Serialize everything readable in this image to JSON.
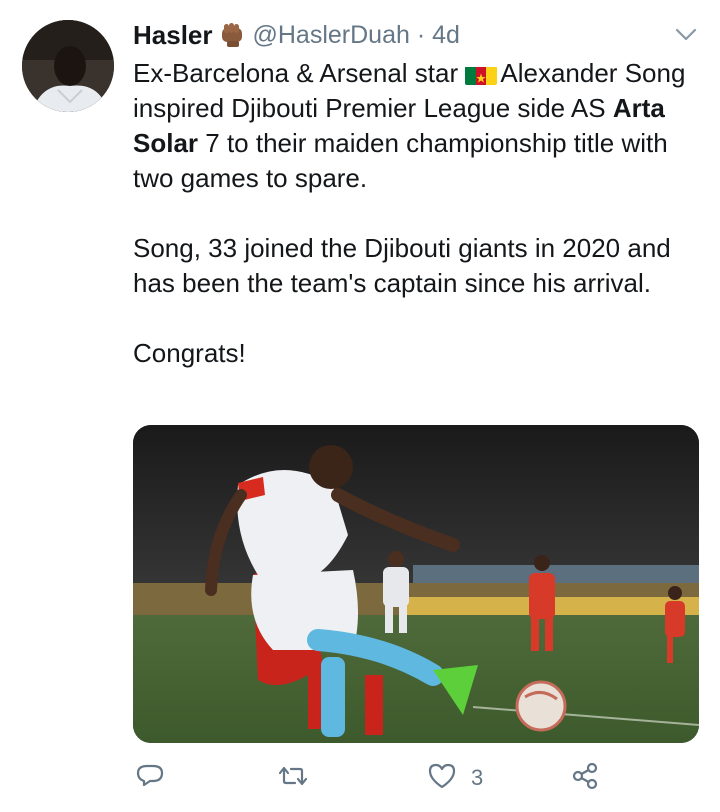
{
  "user": {
    "display_name": "Hasler",
    "handle_time": "@HaslerDuah · 4d",
    "avatar_alt": "profile photo",
    "badge_icon": "raised-fist-icon"
  },
  "tweet": {
    "line1_prefix": "Ex-Barcelona & Arsenal star ",
    "flag_icon": "cameroon-flag-icon",
    "line1_suffix": "Alexander Song inspired Djibouti Premier League side AS ",
    "bold_team": "Arta Solar",
    "line1_end": " 7 to their  maiden championship title with two games to spare.",
    "para2": "Song, 33 joined the Djibouti giants in 2020 and has been the team's captain since his arrival.",
    "para3": "Congrats!"
  },
  "media": {
    "description": "football match photo"
  },
  "actions": {
    "reply_icon": "reply-icon",
    "retweet_icon": "retweet-icon",
    "like_icon": "heart-icon",
    "like_count": "3",
    "share_icon": "share-icon"
  },
  "colors": {
    "text": "#14171a",
    "secondary": "#657786"
  }
}
